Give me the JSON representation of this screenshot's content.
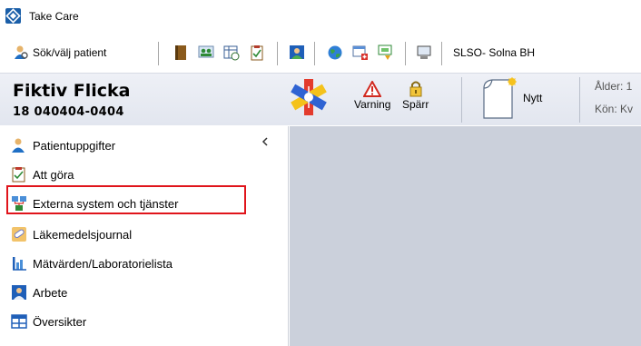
{
  "window": {
    "title": "Take Care"
  },
  "toolbar": {
    "search_patient_label": "Sök/välj patient",
    "unit_label": "SLSO- Solna BH"
  },
  "patient": {
    "name": "Fiktiv Flicka",
    "id": "18 040404-0404"
  },
  "header": {
    "warning_label": "Varning",
    "lock_label": "Spärr",
    "new_label": "Nytt",
    "info_age_label": "Ålder: 1",
    "info_gender_label": "Kön: Kv"
  },
  "sidebar": {
    "items": [
      {
        "label": "Patientuppgifter",
        "icon": "person-icon"
      },
      {
        "label": "Att göra",
        "icon": "checklist-icon"
      },
      {
        "label": "Externa system och tjänster",
        "icon": "network-icon"
      },
      {
        "label": "Läkemedelsjournal",
        "icon": "pill-icon"
      },
      {
        "label": "Mätvärden/Laboratorielista",
        "icon": "chart-icon"
      },
      {
        "label": "Arbete",
        "icon": "worker-icon"
      },
      {
        "label": "Översikter",
        "icon": "grid-icon"
      }
    ]
  },
  "colors": {
    "highlight": "#e0141b",
    "content_bg": "#cbd0db"
  }
}
